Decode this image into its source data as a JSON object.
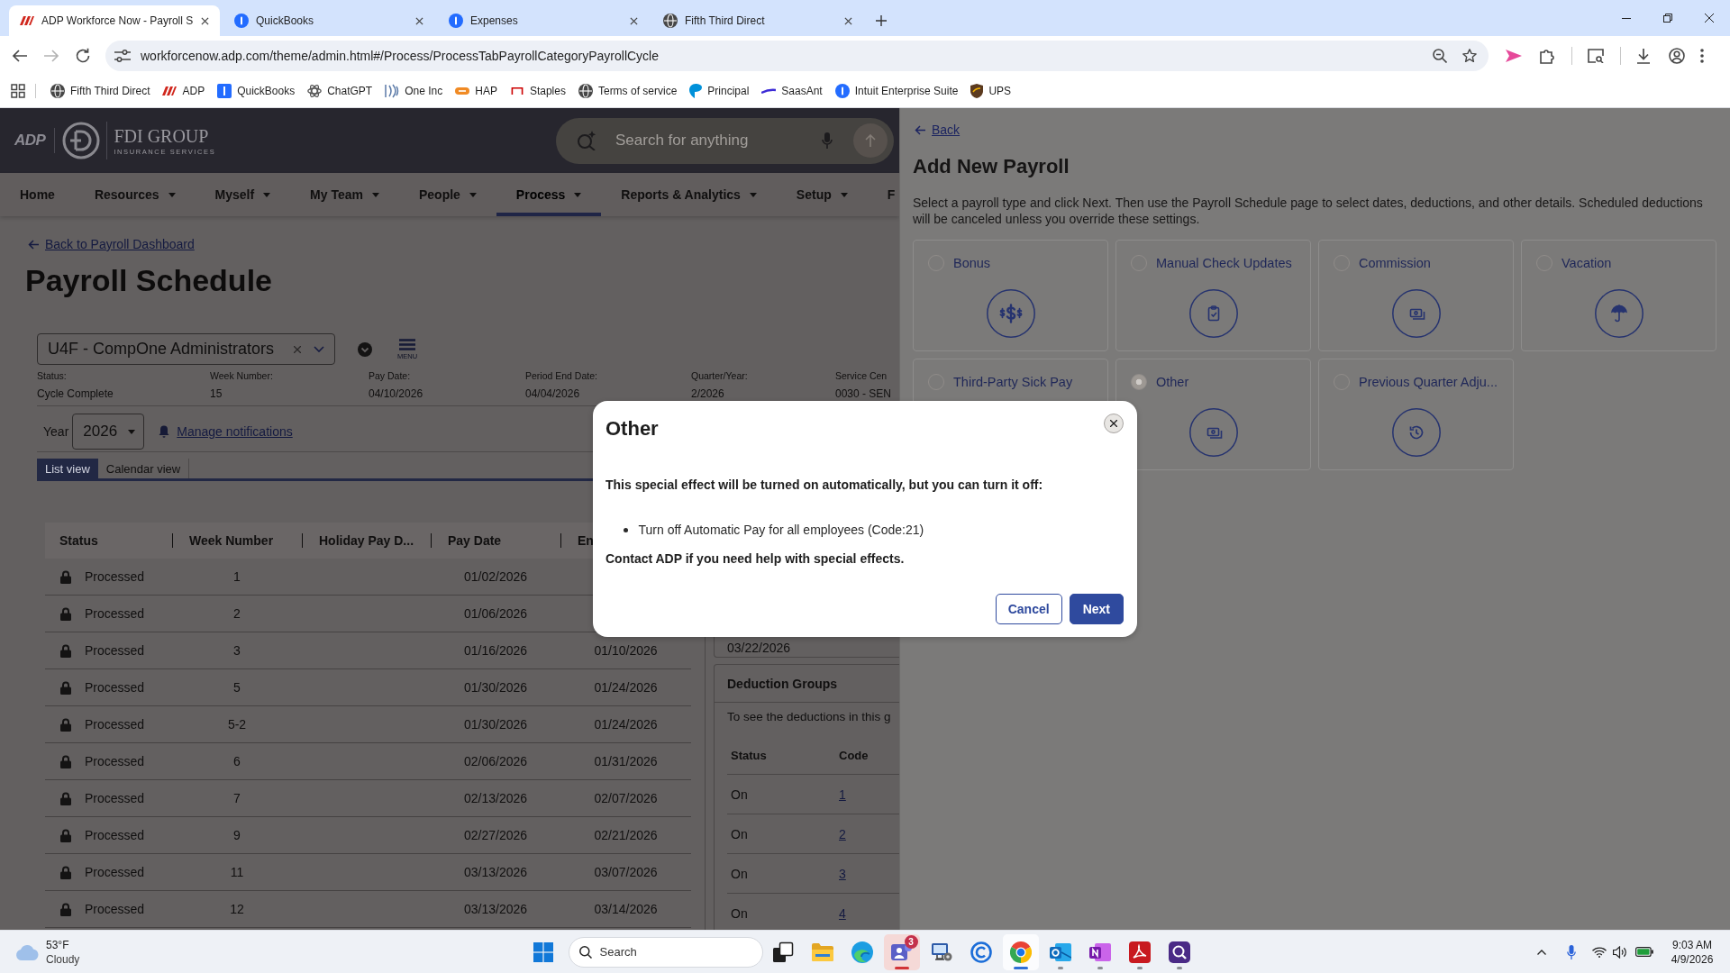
{
  "browser": {
    "tabs": [
      {
        "title": "ADP Workforce Now - Payroll S",
        "kind": "wordmark",
        "selected": true
      },
      {
        "title": "QuickBooks",
        "kind": "info",
        "selected": false
      },
      {
        "title": "Expenses",
        "kind": "info",
        "selected": false
      },
      {
        "title": "Fifth Third Direct",
        "kind": "globe",
        "selected": false
      }
    ],
    "url": "workforcenow.adp.com/theme/admin.html#/Process/ProcessTabPayrollCategoryPayrollCycle",
    "bookmarks": [
      {
        "label": "Fifth Third Direct",
        "kind": "globe"
      },
      {
        "label": "ADP",
        "kind": "wordmark"
      },
      {
        "label": "QuickBooks",
        "kind": "square"
      },
      {
        "label": "ChatGPT",
        "kind": "knot"
      },
      {
        "label": "One Inc",
        "kind": "fan"
      },
      {
        "label": "HAP",
        "kind": "pill"
      },
      {
        "label": "Staples",
        "kind": "staple"
      },
      {
        "label": "Terms of service",
        "kind": "globe"
      },
      {
        "label": "Principal",
        "kind": "leaf"
      },
      {
        "label": "SaasAnt",
        "kind": "swoosh"
      },
      {
        "label": "Intuit Enterprise Suite",
        "kind": "info"
      },
      {
        "label": "UPS",
        "kind": "shield"
      }
    ]
  },
  "app_header": {
    "brand": "ADP",
    "logo_title": "FDI GROUP",
    "logo_subtitle": "INSURANCE SERVICES",
    "search_placeholder": "Search for anything"
  },
  "nav": [
    {
      "label": "Home",
      "dropdown": false,
      "selected": false
    },
    {
      "label": "Resources",
      "dropdown": true,
      "selected": false
    },
    {
      "label": "Myself",
      "dropdown": true,
      "selected": false
    },
    {
      "label": "My Team",
      "dropdown": true,
      "selected": false
    },
    {
      "label": "People",
      "dropdown": true,
      "selected": false
    },
    {
      "label": "Process",
      "dropdown": true,
      "selected": true
    },
    {
      "label": "Reports & Analytics",
      "dropdown": true,
      "selected": false
    },
    {
      "label": "Setup",
      "dropdown": true,
      "selected": false
    },
    {
      "label": "F",
      "dropdown": false,
      "selected": false
    }
  ],
  "payroll_schedule": {
    "back_link": "Back to Payroll Dashboard",
    "title": "Payroll Schedule",
    "company": "U4F - CompOne Administrators",
    "menu_label": "MENU",
    "summary": [
      {
        "label": "Status:",
        "value": "Cycle Complete"
      },
      {
        "label": "Week Number:",
        "value": "15"
      },
      {
        "label": "Pay Date:",
        "value": "04/10/2026"
      },
      {
        "label": "Period End Date:",
        "value": "04/04/2026"
      },
      {
        "label": "Quarter/Year:",
        "value": "2/2026"
      },
      {
        "label": "Service Cen",
        "value": "0030 - SEN"
      }
    ],
    "year_label": "Year",
    "year": "2026",
    "notifications_link": "Manage notifications",
    "views": [
      {
        "label": "List view",
        "selected": true
      },
      {
        "label": "Calendar view",
        "selected": false
      }
    ],
    "table": {
      "columns": [
        "Status",
        "Week Number",
        "Holiday Pay D...",
        "Pay Date",
        "En"
      ],
      "rows": [
        {
          "status": "Processed",
          "locked": true,
          "week_number": "1",
          "pay_date": "01/02/2026"
        },
        {
          "status": "Processed",
          "locked": true,
          "week_number": "2",
          "pay_date": "01/06/2026"
        },
        {
          "status": "Processed",
          "locked": true,
          "week_number": "3",
          "pay_date": "01/16/2026",
          "end_date": "01/10/2026"
        },
        {
          "status": "Processed",
          "locked": true,
          "week_number": "5",
          "pay_date": "01/30/2026",
          "end_date": "01/24/2026"
        },
        {
          "status": "Processed",
          "locked": true,
          "week_number": "5-2",
          "pay_date": "01/30/2026",
          "end_date": "01/24/2026"
        },
        {
          "status": "Processed",
          "locked": true,
          "week_number": "6",
          "pay_date": "02/06/2026",
          "end_date": "01/31/2026"
        },
        {
          "status": "Processed",
          "locked": true,
          "week_number": "7",
          "pay_date": "02/13/2026",
          "end_date": "02/07/2026"
        },
        {
          "status": "Processed",
          "locked": true,
          "week_number": "9",
          "pay_date": "02/27/2026",
          "end_date": "02/21/2026"
        },
        {
          "status": "Processed",
          "locked": true,
          "week_number": "11",
          "pay_date": "03/13/2026",
          "end_date": "03/07/2026"
        },
        {
          "status": "Processed",
          "locked": true,
          "week_number": "12",
          "pay_date": "03/13/2026",
          "end_date": "03/14/2026"
        }
      ]
    },
    "date_card": {
      "date": "03/22/2026"
    },
    "deduction_groups": {
      "title": "Deduction Groups",
      "note": "To see the deductions in this g",
      "columns": [
        "Status",
        "Code"
      ],
      "rows": [
        {
          "status": "On",
          "code": "1"
        },
        {
          "status": "On",
          "code": "2"
        },
        {
          "status": "On",
          "code": "3"
        },
        {
          "status": "On",
          "code": "4"
        }
      ]
    }
  },
  "add_payroll": {
    "back_link": "Back",
    "title": "Add New Payroll",
    "description": "Select a payroll type and click Next. Then use the Payroll Schedule page to select dates, deductions, and other details. Scheduled deductions will be canceled unless you override these settings.",
    "types": [
      {
        "label": "Bonus",
        "kind": "dollars",
        "selected": false
      },
      {
        "label": "Manual Check Updates",
        "kind": "clipboard",
        "selected": false
      },
      {
        "label": "Commission",
        "kind": "cash",
        "selected": false
      },
      {
        "label": "Vacation",
        "kind": "umbrella",
        "selected": false
      },
      {
        "label": "Third-Party Sick Pay",
        "selected": false
      },
      {
        "label": "Other",
        "kind": "cash",
        "selected": true
      },
      {
        "label": "Previous Quarter Adju...",
        "kind": "history",
        "selected": false
      }
    ]
  },
  "dialog": {
    "title": "Other",
    "message": "This special effect will be turned on automatically, but you can turn it off:",
    "effects": [
      "Turn off Automatic Pay for all employees (Code:21)"
    ],
    "note": "Contact ADP if you need help with special effects.",
    "buttons": [
      {
        "label": "Cancel",
        "kind": "secondary"
      },
      {
        "label": "Next",
        "kind": "primary"
      }
    ]
  },
  "taskbar": {
    "weather": {
      "temperature": "53°F",
      "condition": "Cloudy"
    },
    "search_placeholder": "Search",
    "apps": [
      {
        "kind": "stack",
        "open": false,
        "selected": false,
        "attention": false
      },
      {
        "kind": "folder",
        "open": false,
        "selected": false,
        "attention": false
      },
      {
        "kind": "swirl",
        "open": false,
        "selected": false,
        "attention": false
      },
      {
        "kind": "people",
        "open": true,
        "selected": false,
        "attention": true,
        "badge": "3"
      },
      {
        "kind": "monitor",
        "open": false,
        "selected": false,
        "attention": false
      },
      {
        "kind": "ring",
        "open": false,
        "selected": false,
        "attention": false
      },
      {
        "kind": "wheel",
        "open": true,
        "selected": true,
        "attention": false
      },
      {
        "kind": "mail",
        "open": true,
        "selected": false,
        "attention": false
      },
      {
        "kind": "note",
        "open": true,
        "selected": false,
        "attention": false
      },
      {
        "kind": "curve",
        "open": true,
        "selected": false,
        "attention": false
      },
      {
        "kind": "lens",
        "open": true,
        "selected": false,
        "attention": false
      }
    ],
    "time": "9:03 AM",
    "date": "4/9/2026"
  }
}
